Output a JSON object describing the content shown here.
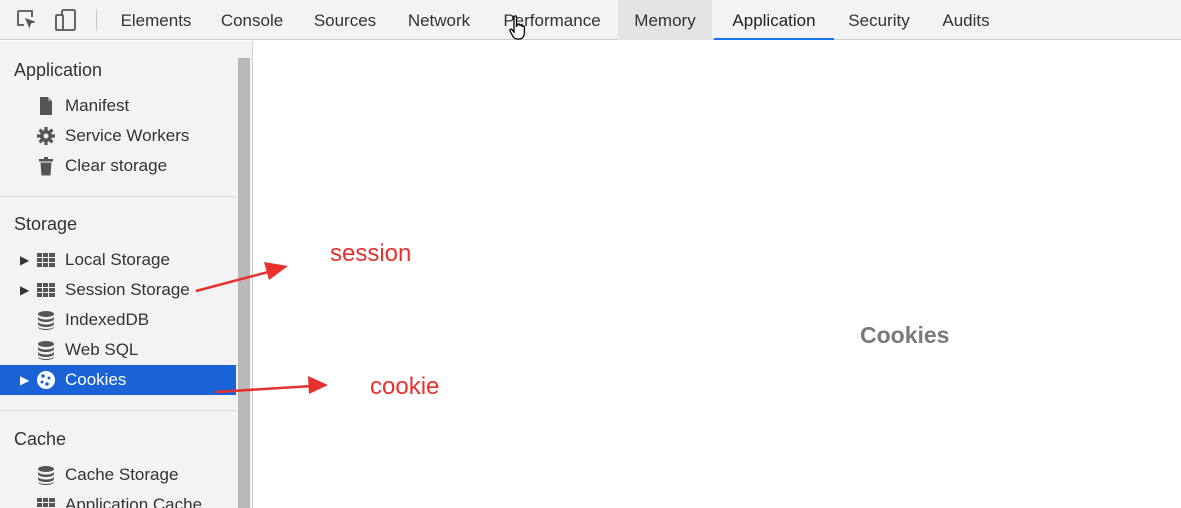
{
  "toolbar": {
    "tabs": [
      "Elements",
      "Console",
      "Sources",
      "Network",
      "Performance",
      "Memory",
      "Application",
      "Security",
      "Audits"
    ],
    "hovered_tab": "Memory",
    "active_tab": "Application"
  },
  "sidebar": {
    "sections": [
      {
        "title": "Application",
        "items": [
          {
            "label": "Manifest",
            "icon": "document-icon"
          },
          {
            "label": "Service Workers",
            "icon": "gear-icon"
          },
          {
            "label": "Clear storage",
            "icon": "trash-icon"
          }
        ]
      },
      {
        "title": "Storage",
        "items": [
          {
            "label": "Local Storage",
            "icon": "grid-icon",
            "expandable": true
          },
          {
            "label": "Session Storage",
            "icon": "grid-icon",
            "expandable": true
          },
          {
            "label": "IndexedDB",
            "icon": "database-icon"
          },
          {
            "label": "Web SQL",
            "icon": "database-icon"
          },
          {
            "label": "Cookies",
            "icon": "cookie-icon",
            "expandable": true,
            "selected": true
          }
        ]
      },
      {
        "title": "Cache",
        "items": [
          {
            "label": "Cache Storage",
            "icon": "database-icon"
          },
          {
            "label": "Application Cache",
            "icon": "grid-icon"
          }
        ]
      }
    ]
  },
  "main": {
    "title": "Cookies"
  },
  "annotations": {
    "session": "session",
    "cookie": "cookie",
    "color": "#e8312c"
  },
  "colors": {
    "accent": "#1a73e8",
    "selection": "#1a63d6"
  }
}
